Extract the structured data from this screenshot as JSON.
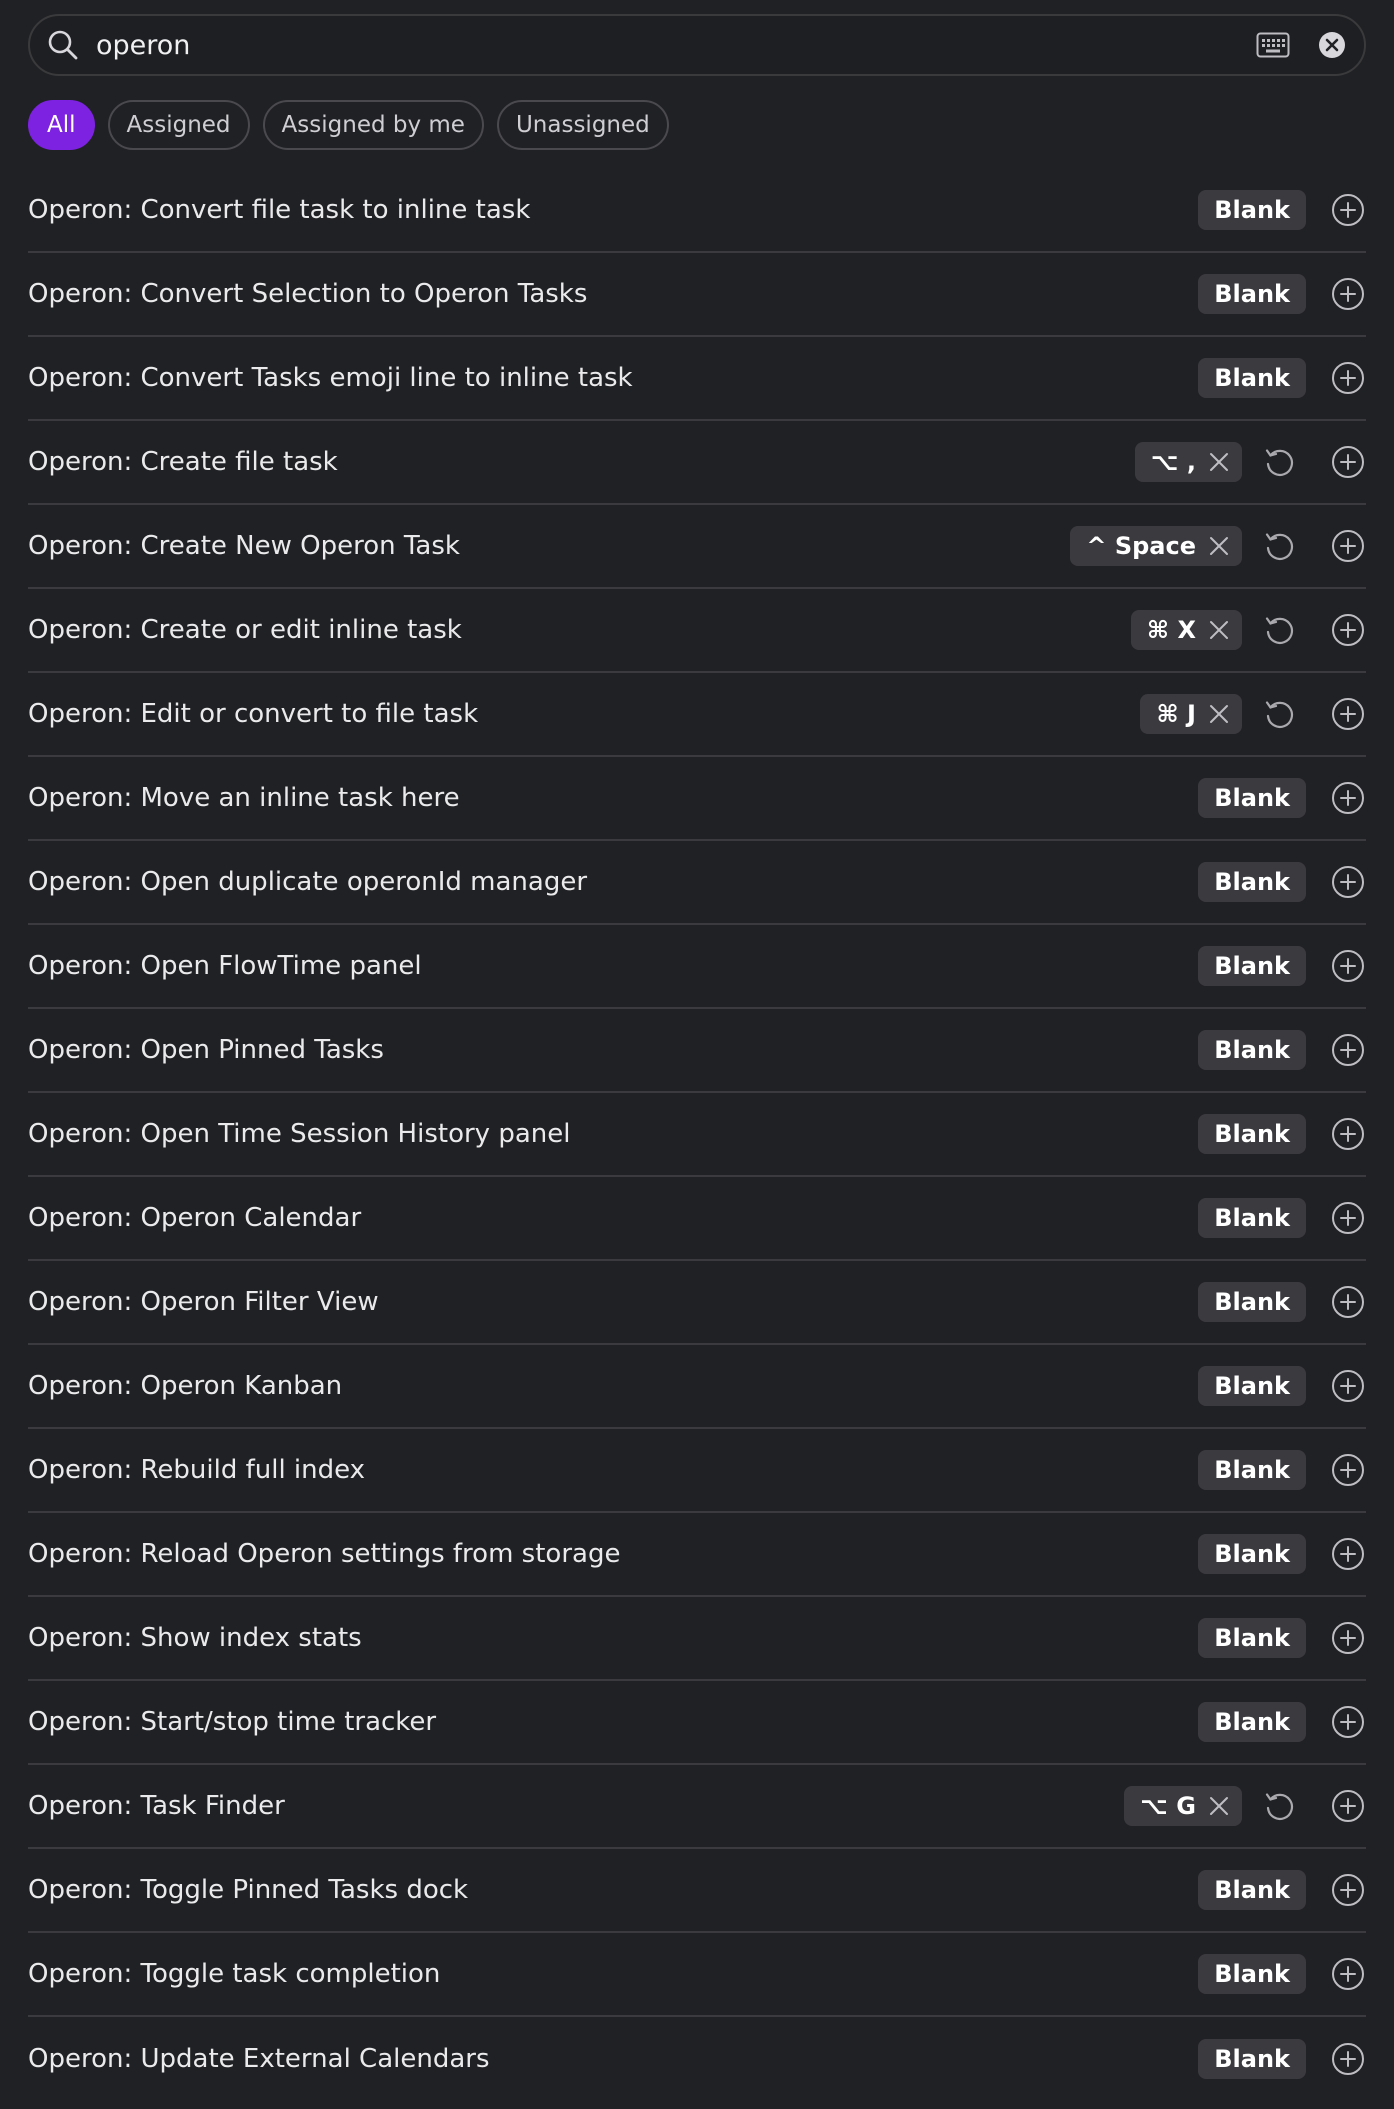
{
  "search": {
    "value": "operon",
    "icon": "search-icon",
    "keyboard_icon": "keyboard-icon",
    "clear_icon": "clear-icon"
  },
  "filters": [
    {
      "label": "All",
      "active": true
    },
    {
      "label": "Assigned",
      "active": false
    },
    {
      "label": "Assigned by me",
      "active": false
    },
    {
      "label": "Unassigned",
      "active": false
    }
  ],
  "colors": {
    "accent": "#7c22e0",
    "background": "#202124",
    "badge": "#3b3b3f",
    "divider": "#3b3b3f"
  },
  "blank_label": "Blank",
  "commands": [
    {
      "label": "Operon: Convert file task to inline task",
      "hotkey": null
    },
    {
      "label": "Operon: Convert Selection to Operon Tasks",
      "hotkey": null
    },
    {
      "label": "Operon: Convert Tasks emoji line to inline task",
      "hotkey": null
    },
    {
      "label": "Operon: Create file task",
      "hotkey": "⌥ ,"
    },
    {
      "label": "Operon: Create New Operon Task",
      "hotkey": "^ Space"
    },
    {
      "label": "Operon: Create or edit inline task",
      "hotkey": "⌘ X"
    },
    {
      "label": "Operon: Edit or convert to file task",
      "hotkey": "⌘ J"
    },
    {
      "label": "Operon: Move an inline task here",
      "hotkey": null
    },
    {
      "label": "Operon: Open duplicate operonId manager",
      "hotkey": null
    },
    {
      "label": "Operon: Open FlowTime panel",
      "hotkey": null
    },
    {
      "label": "Operon: Open Pinned Tasks",
      "hotkey": null
    },
    {
      "label": "Operon: Open Time Session History panel",
      "hotkey": null
    },
    {
      "label": "Operon: Operon Calendar",
      "hotkey": null
    },
    {
      "label": "Operon: Operon Filter View",
      "hotkey": null
    },
    {
      "label": "Operon: Operon Kanban",
      "hotkey": null
    },
    {
      "label": "Operon: Rebuild full index",
      "hotkey": null
    },
    {
      "label": "Operon: Reload Operon settings from storage",
      "hotkey": null
    },
    {
      "label": "Operon: Show index stats",
      "hotkey": null
    },
    {
      "label": "Operon: Start/stop time tracker",
      "hotkey": null
    },
    {
      "label": "Operon: Task Finder",
      "hotkey": "⌥ G"
    },
    {
      "label": "Operon: Toggle Pinned Tasks dock",
      "hotkey": null
    },
    {
      "label": "Operon: Toggle task completion",
      "hotkey": null
    },
    {
      "label": "Operon: Update External Calendars",
      "hotkey": null
    }
  ]
}
